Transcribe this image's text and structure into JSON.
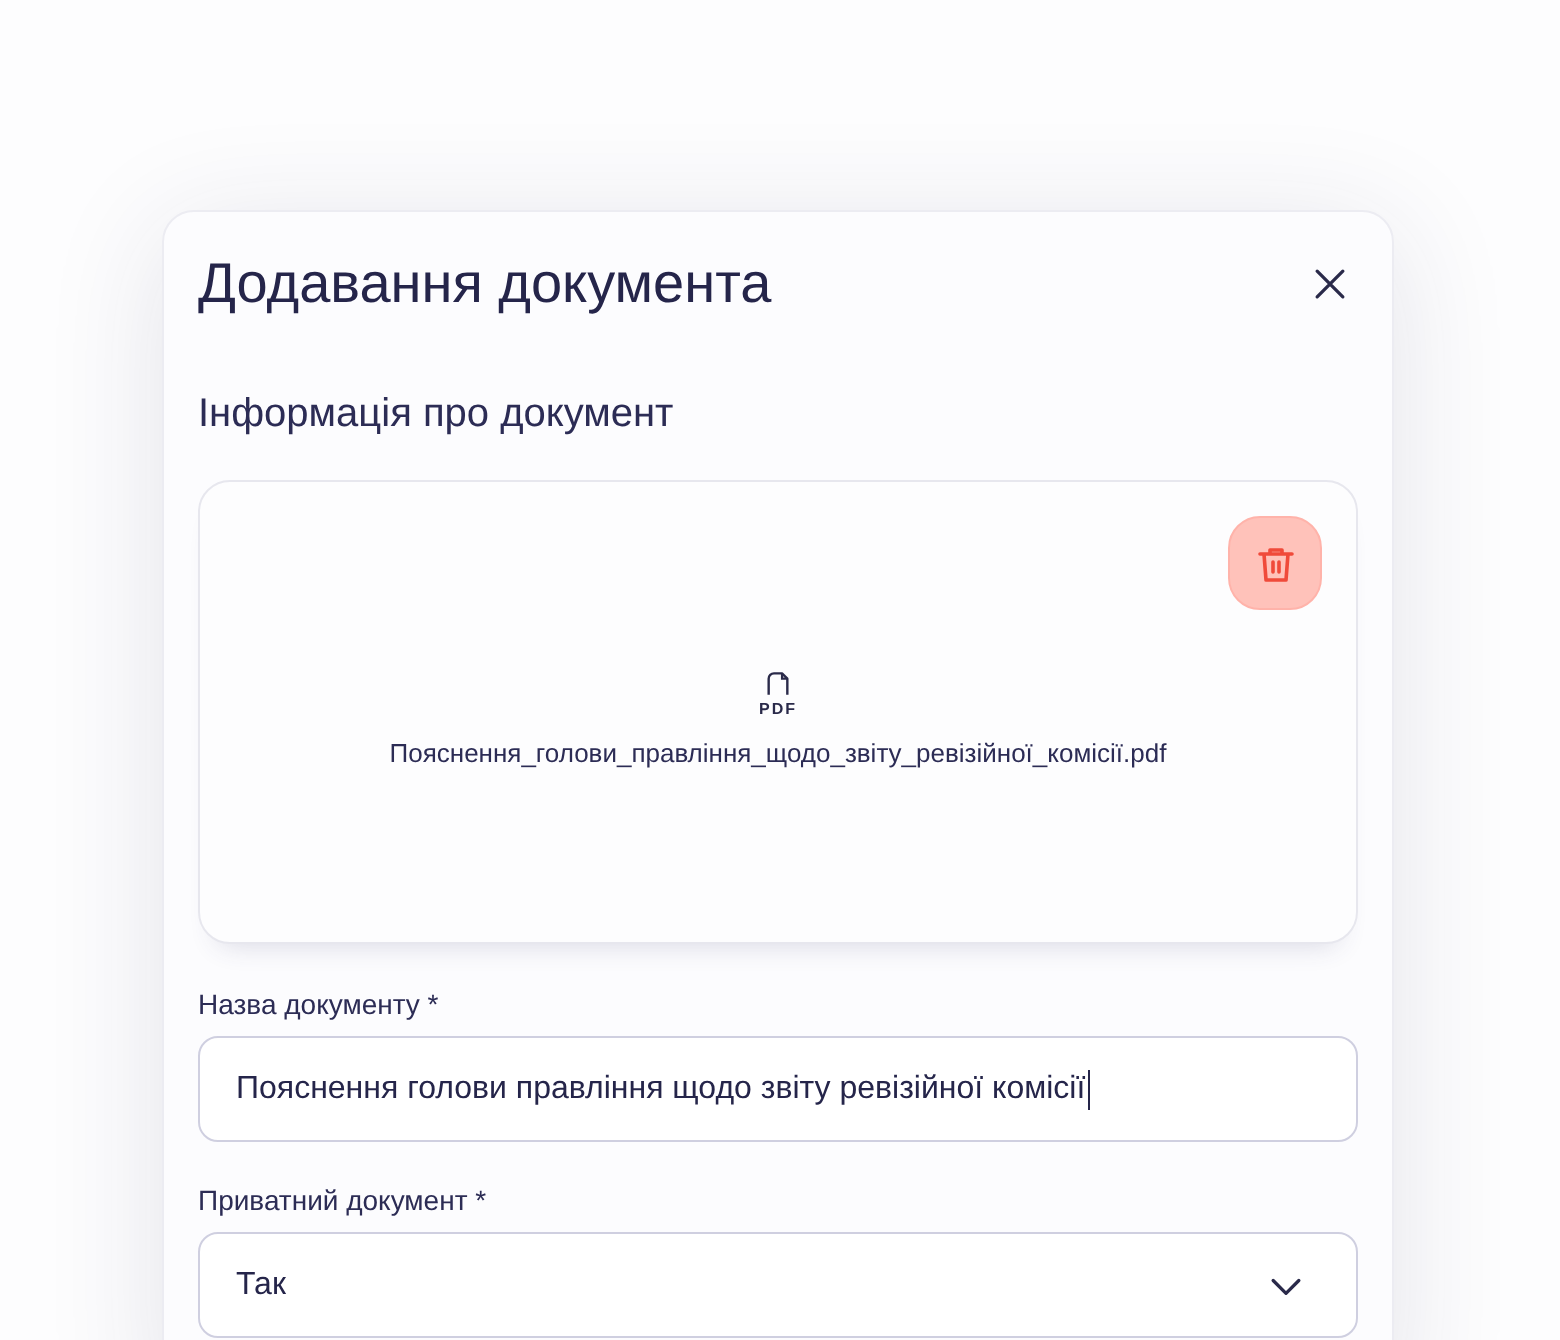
{
  "dialog": {
    "title": "Додавання документа",
    "section_title": "Інформація про документ",
    "file": {
      "type_label": "PDF",
      "name": "Пояснення_голови_правління_щодо_звіту_ревізійної_комісії.pdf"
    },
    "fields": [
      {
        "kind": "text",
        "label": "Назва документу *",
        "value": "Пояснення голови правління щодо звіту ревізійної комісії",
        "focused": true
      },
      {
        "kind": "select",
        "label": "Приватний документ *",
        "value": "Так"
      }
    ]
  }
}
